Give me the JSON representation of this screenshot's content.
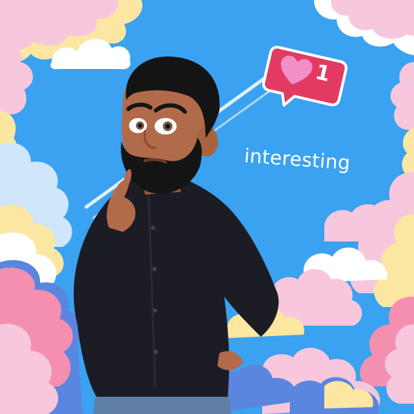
{
  "notification": {
    "icon": "heart-icon",
    "count": "1",
    "colors": {
      "badge": "#e23a63",
      "heart": "#f28fc9",
      "outline": "#ffffff"
    }
  },
  "caption": {
    "text": "interesting"
  },
  "colors": {
    "sky": "#3aa2f0",
    "cloud_pink": "#f7c7dd",
    "cloud_hot_pink": "#f58fb0",
    "cloud_yellow": "#fbe7a1",
    "cloud_blue": "#5b86e0",
    "cloud_white": "#ffffff",
    "shirt": "#1c1c24",
    "skin": "#b26b4a",
    "hair": "#141414"
  }
}
